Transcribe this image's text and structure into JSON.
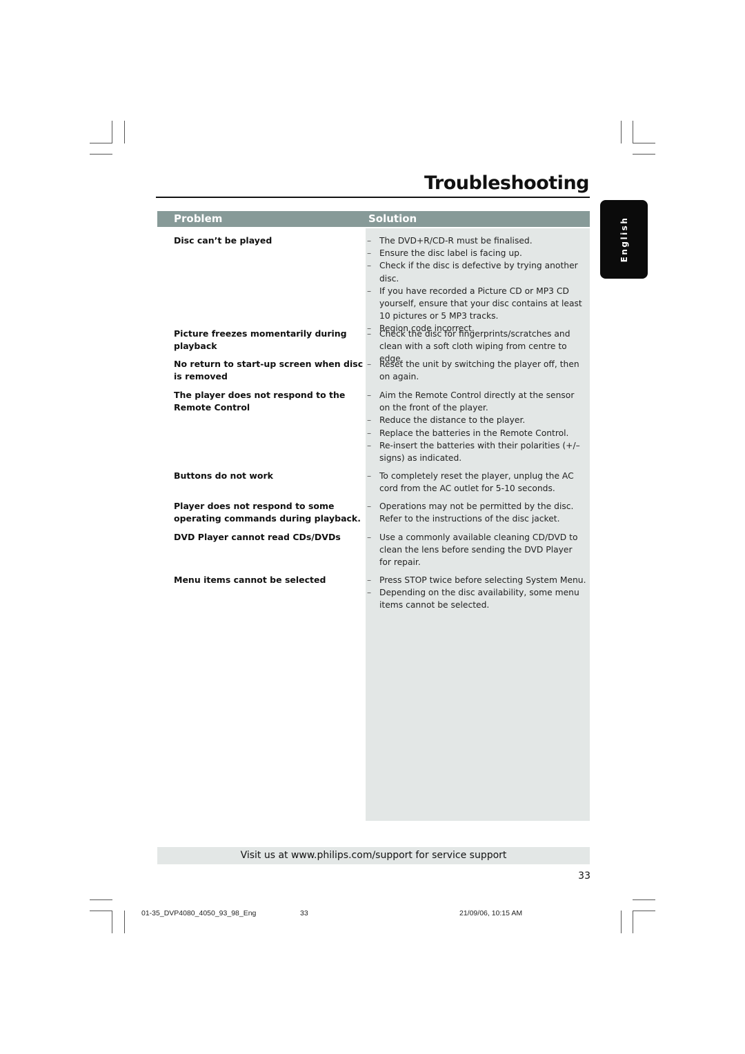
{
  "page": {
    "title": "Troubleshooting",
    "language_tab": "English",
    "page_number": "33"
  },
  "table": {
    "header_problem": "Problem",
    "header_solution": "Solution",
    "rows": [
      {
        "problem": "Disc can’t be played",
        "solutions": [
          "The DVD+R/CD-R must be finalised.",
          "Ensure the disc label is facing up.",
          "Check if the disc is defective by trying another disc.",
          "If you have recorded a Picture CD or MP3 CD yourself, ensure that your disc contains at least 10 pictures or 5 MP3 tracks.",
          "Region code incorrect."
        ]
      },
      {
        "problem": "Picture freezes momentarily during playback",
        "solutions": [
          "Check the disc for fingerprints/scratches and clean with a soft cloth wiping from centre to edge."
        ]
      },
      {
        "problem": "No return to start-up screen when disc is removed",
        "solutions": [
          "Reset the unit by switching the player off, then on again."
        ]
      },
      {
        "problem": "The player does not respond to the Remote Control",
        "solutions": [
          "Aim the Remote Control directly at the sensor on the front of the player.",
          "Reduce the distance to the player.",
          "Replace the batteries in the Remote Control.",
          "Re-insert the batteries with their polarities (+/– signs) as indicated."
        ]
      },
      {
        "problem": "Buttons do not work",
        "solutions": [
          "To completely reset the player, unplug the AC cord from the AC outlet for 5-10 seconds."
        ]
      },
      {
        "problem": "Player does not respond to some operating commands during playback.",
        "solutions": [
          "Operations may not be permitted by the disc. Refer to the instructions of  the disc jacket."
        ]
      },
      {
        "problem": "DVD Player cannot read CDs/DVDs",
        "solutions": [
          "Use a commonly available cleaning CD/DVD to clean the lens before sending the DVD Player for repair."
        ]
      },
      {
        "problem": "Menu items cannot be selected",
        "solutions": [
          "Press STOP twice before selecting System Menu.",
          "Depending on the disc availability, some menu items cannot be selected."
        ]
      }
    ]
  },
  "support": {
    "text": "Visit us at www.philips.com/support for service support"
  },
  "print_footer": {
    "filename": "01-35_DVP4080_4050_93_98_Eng",
    "page": "33",
    "datetime": "21/09/06, 10:15 AM"
  },
  "dash_char": "–"
}
